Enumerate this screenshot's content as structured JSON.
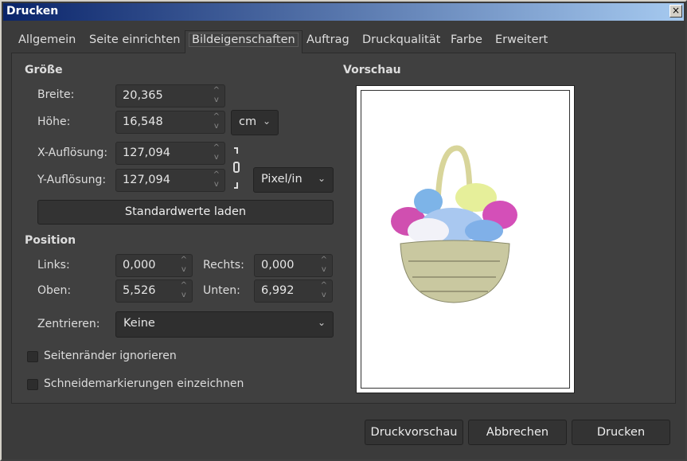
{
  "window": {
    "title": "Drucken",
    "close": "×"
  },
  "tabs": [
    "Allgemein",
    "Seite einrichten",
    "Bildeigenschaften",
    "Auftrag",
    "Druckqualität",
    "Farbe",
    "Erweitert"
  ],
  "size": {
    "heading": "Größe",
    "width_label": "Breite:",
    "width": "20,365",
    "height_label": "Höhe:",
    "height": "16,548",
    "unit": "cm",
    "xres_label": "X-Auflösung:",
    "xres": "127,094",
    "yres_label": "Y-Auflösung:",
    "yres": "127,094",
    "res_unit": "Pixel/in",
    "reset": "Standardwerte laden"
  },
  "position": {
    "heading": "Position",
    "left_label": "Links:",
    "left": "0,000",
    "right_label": "Rechts:",
    "right": "0,000",
    "top_label": "Oben:",
    "top": "5,526",
    "bottom_label": "Unten:",
    "bottom": "6,992",
    "center_label": "Zentrieren:",
    "center": "Keine"
  },
  "options": {
    "ignore_margins": "Seitenränder ignorieren",
    "crop_marks": "Schneidemarkierungen einzeichnen"
  },
  "preview": {
    "heading": "Vorschau"
  },
  "buttons": {
    "preview": "Druckvorschau",
    "cancel": "Abbrechen",
    "print": "Drucken"
  }
}
